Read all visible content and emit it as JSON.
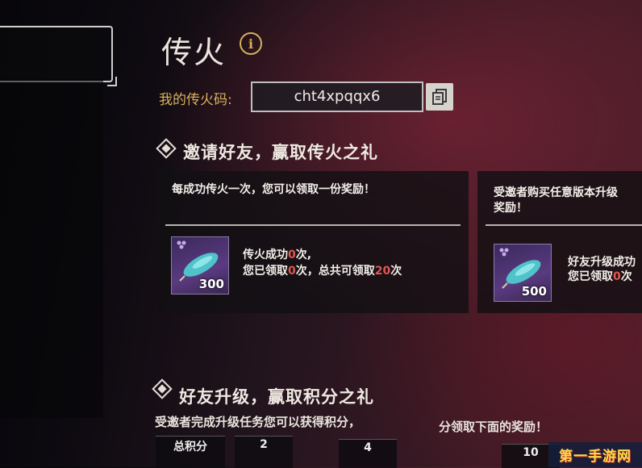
{
  "header": {
    "title": "传火",
    "code_label": "我的传火码:",
    "code_value": "cht4xpqqx6"
  },
  "invite_section": {
    "title": "邀请好友，赢取传火之礼",
    "card1": {
      "description": "每成功传火一次，您可以领取一份奖励！",
      "reward_qty": "300",
      "line1_prefix": "传火成功",
      "line1_count": "0",
      "line1_suffix": "次,",
      "line2_prefix": "您已领取",
      "line2_count": "0",
      "line2_mid": "次，总共可领取",
      "line2_total": "20",
      "line2_suffix": "次"
    },
    "card2": {
      "description_line1": "受邀者购买任意版本升级",
      "description_line2": "奖励！",
      "reward_qty": "500",
      "line1": "好友升级成功",
      "line2_prefix": "您已领取",
      "line2_count": "0",
      "line2_suffix": "次"
    }
  },
  "upgrade_section": {
    "title": "好友升级，赢取积分之礼",
    "desc_left": "受邀者完成升级任务您可以获得积分，",
    "desc_right": "分领取下面的奖励！",
    "total_points_label": "总积分",
    "milestones": [
      "2",
      "4",
      "10"
    ]
  },
  "watermark": "第一手游网",
  "colors": {
    "gold": "#d8b15e",
    "highlight": "#e2564f",
    "reward_purple": "#5a3a80"
  }
}
